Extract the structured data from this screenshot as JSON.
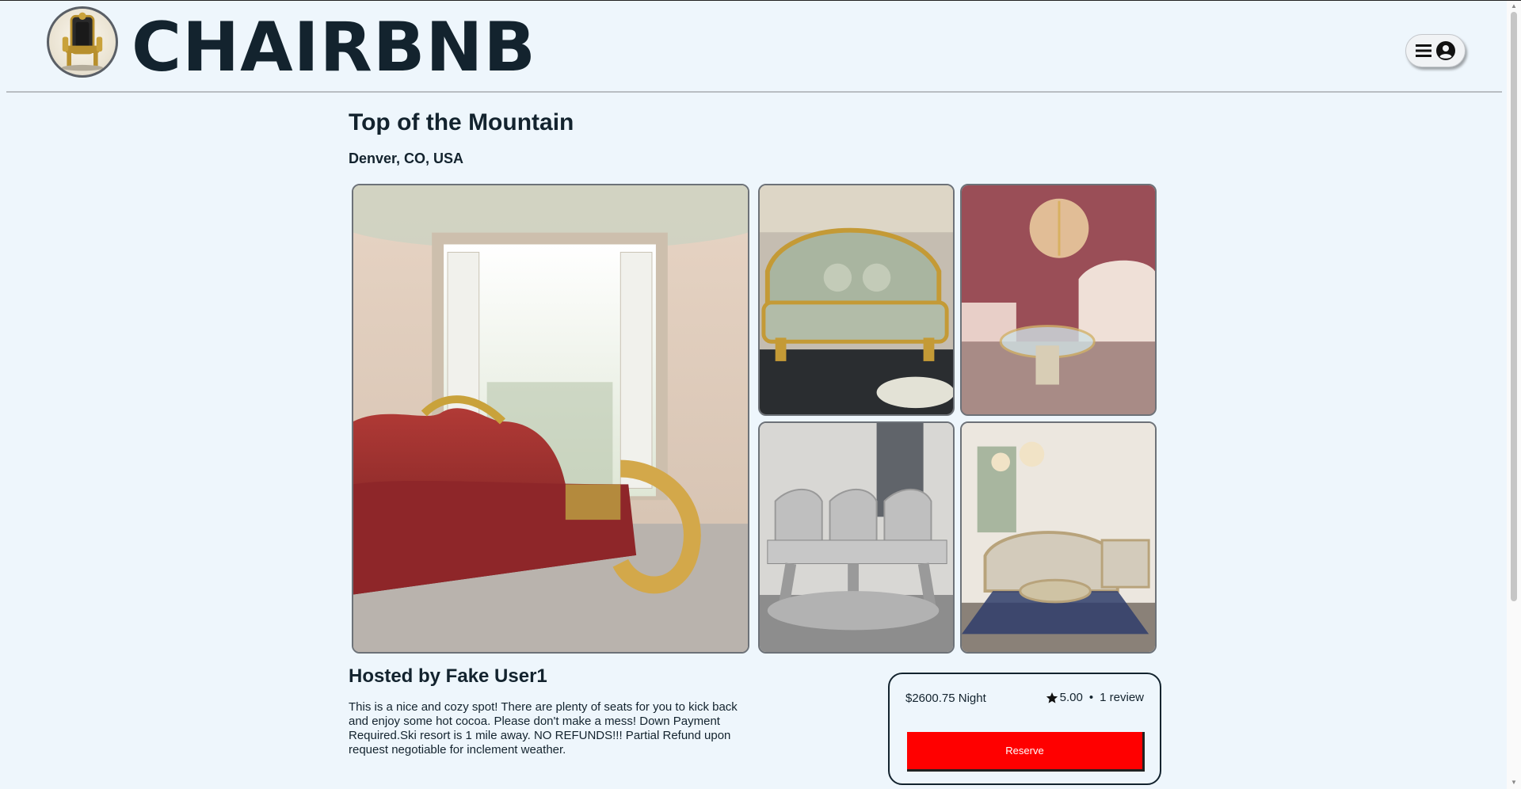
{
  "header": {
    "logo_text": "CHAIRBNB"
  },
  "listing": {
    "title": "Top of the Mountain",
    "location": "Denver, CO, USA",
    "hosted_by": "Hosted by Fake User1",
    "description": "This is a nice and cozy spot! There are plenty of seats for you to kick back and enjoy some hot cocoa. Please don't make a mess! Down Payment Required.Ski resort is 1 mile away. NO REFUNDS!!! Partial Refund upon request negotiable for inclement weather."
  },
  "booking": {
    "price": "$2600.75 Night",
    "rating": "5.00",
    "separator": "•",
    "reviews": "1 review",
    "reserve_label": "Reserve"
  },
  "colors": {
    "background": "#eef6fc",
    "text": "#13232e",
    "reserve_button": "#ff0000"
  }
}
